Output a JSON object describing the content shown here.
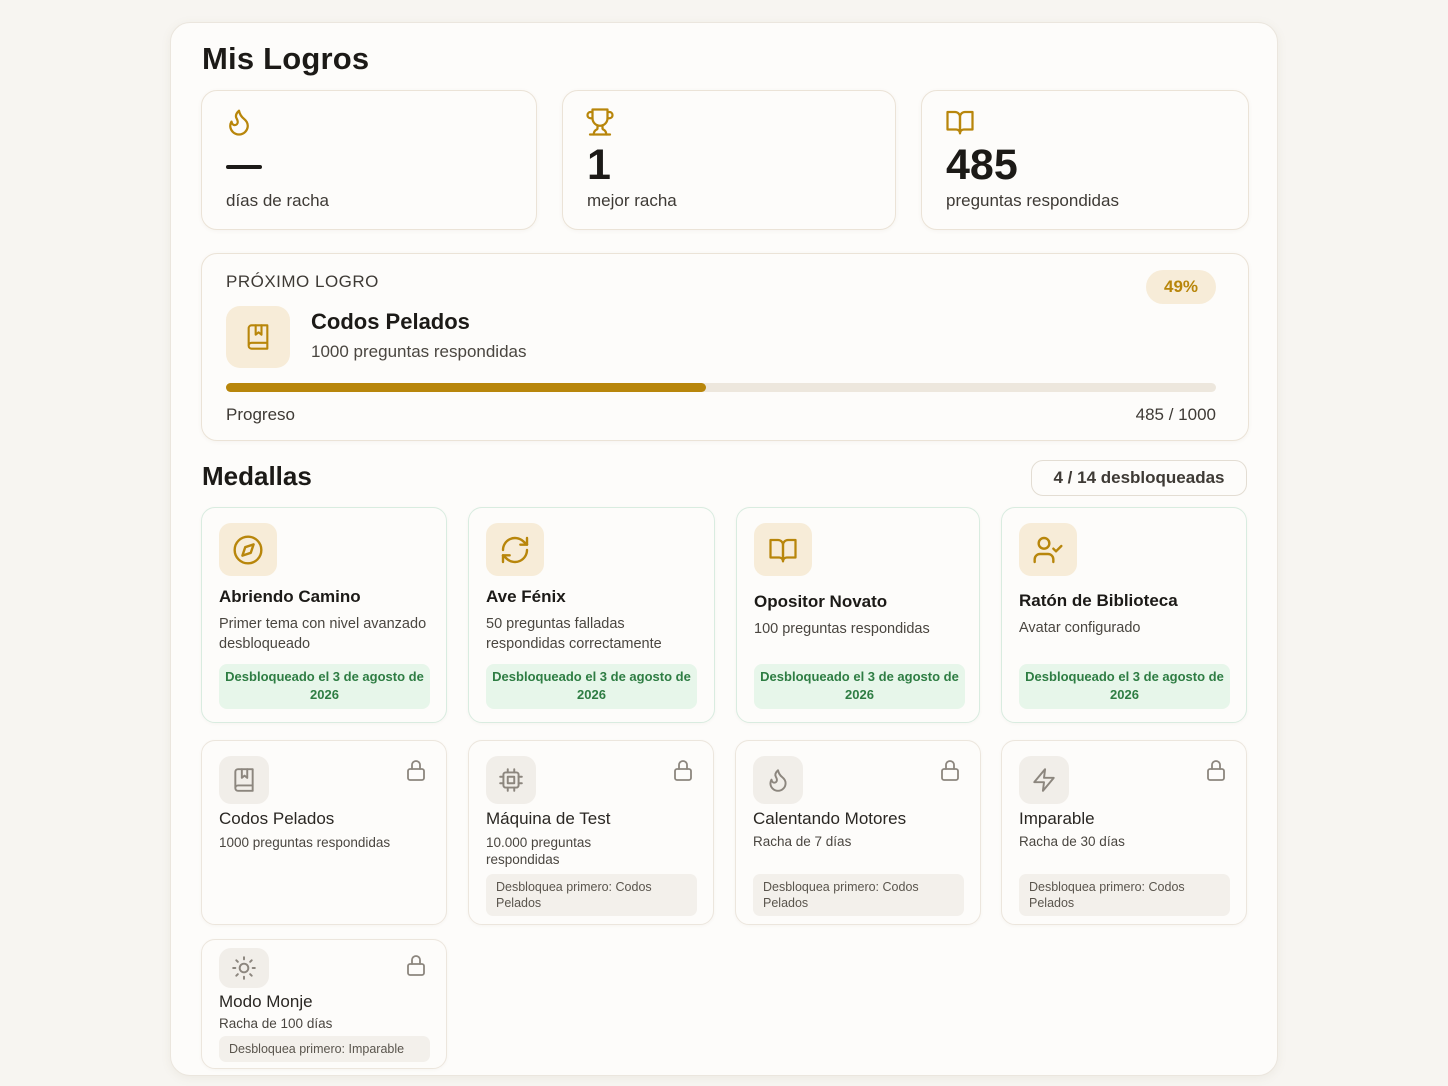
{
  "page": {
    "title": "Mis Logros"
  },
  "stats": [
    {
      "icon": "flame-icon",
      "value": "",
      "label": "días de racha"
    },
    {
      "icon": "trophy-icon",
      "value": "1",
      "label": "mejor racha"
    },
    {
      "icon": "book-open-icon",
      "value": "485",
      "label": "preguntas respondidas"
    }
  ],
  "next_achievement": {
    "section_label": "PRÓXIMO LOGRO",
    "percent_label": "49%",
    "icon": "book-bookmark-icon",
    "name": "Codos Pelados",
    "description": "1000 preguntas respondidas",
    "progress_label": "Progreso",
    "progress_count": "485 / 1000",
    "progress_fraction": 0.485
  },
  "medals_section": {
    "title": "Medallas",
    "unlocked_count": "4 / 14 desbloqueadas"
  },
  "medals": [
    {
      "name": "Abriendo Camino",
      "description": "Primer tema con nivel avanzado desbloqueado",
      "icon": "compass-icon",
      "status": "Desbloqueado el 3 de agosto de 2026"
    },
    {
      "name": "Ave Fénix",
      "description": "50 preguntas falladas respondidas correctamente",
      "icon": "refresh-icon",
      "status": "Desbloqueado el 3 de agosto de 2026"
    },
    {
      "name": "Opositor Novato",
      "description": "100 preguntas respondidas",
      "icon": "book-open-icon",
      "status": "Desbloqueado el 3 de agosto de 2026"
    },
    {
      "name": "Ratón de Biblioteca",
      "description": "Avatar configurado",
      "icon": "user-check-icon",
      "status": "Desbloqueado el 3 de agosto de 2026"
    },
    {
      "name": "Codos Pelados",
      "description": "1000 preguntas respondidas",
      "icon": "book-bookmark-icon",
      "status": ""
    },
    {
      "name": "Máquina de Test",
      "description": "10.000 preguntas respondidas",
      "icon": "cpu-icon",
      "status": "Desbloquea primero: Codos Pelados"
    },
    {
      "name": "Calentando Motores",
      "description": "Racha de 7 días",
      "icon": "flame-icon",
      "status": "Desbloquea primero: Codos Pelados"
    },
    {
      "name": "Imparable",
      "description": "Racha de 30 días",
      "icon": "lightning-icon",
      "status": "Desbloquea primero: Codos Pelados"
    },
    {
      "name": "Modo Monje",
      "description": "Racha de 100 días",
      "icon": "sun-icon",
      "status": "Desbloquea primero: Imparable"
    }
  ],
  "colors": {
    "accent": "#b8860b",
    "accent_bg": "#f7ecd8",
    "unlocked_bg": "#e7f6ea",
    "unlocked_text": "#2e7d43"
  }
}
